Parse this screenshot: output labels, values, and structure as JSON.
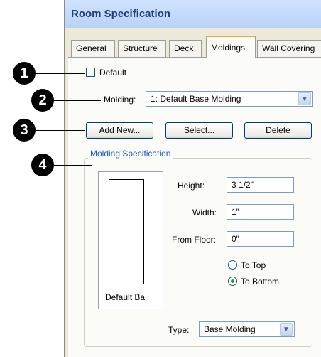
{
  "window": {
    "title": "Room Specification"
  },
  "tabs": [
    {
      "label": "General"
    },
    {
      "label": "Structure"
    },
    {
      "label": "Deck"
    },
    {
      "label": "Moldings"
    },
    {
      "label": "Wall Covering"
    }
  ],
  "active_tab": "Moldings",
  "default_checkbox": {
    "label": "Default",
    "checked": false
  },
  "molding": {
    "label": "Molding:",
    "value": "1: Default Base Molding"
  },
  "buttons": {
    "add_new": "Add New...",
    "select": "Select...",
    "delete": "Delete"
  },
  "spec": {
    "title": "Molding Specification",
    "preview_caption": "Default Ba",
    "height_label": "Height:",
    "height_value": "3 1/2\"",
    "width_label": "Width:",
    "width_value": "1\"",
    "from_floor_label": "From Floor:",
    "from_floor_value": "0\"",
    "to_top_label": "To Top",
    "to_bottom_label": "To Bottom",
    "selected_position": "To Bottom",
    "type_label": "Type:",
    "type_value": "Base Molding"
  },
  "callouts": [
    "1",
    "2",
    "3",
    "4"
  ],
  "icons": {
    "dropdown": "chevron-down-icon",
    "radio_selected": "radio-dot-icon"
  },
  "colors": {
    "title_text": "#1d3f7a",
    "group_title": "#2157c7",
    "active_tab_accent": "#f0a83c",
    "radio_dot": "#21a121"
  }
}
